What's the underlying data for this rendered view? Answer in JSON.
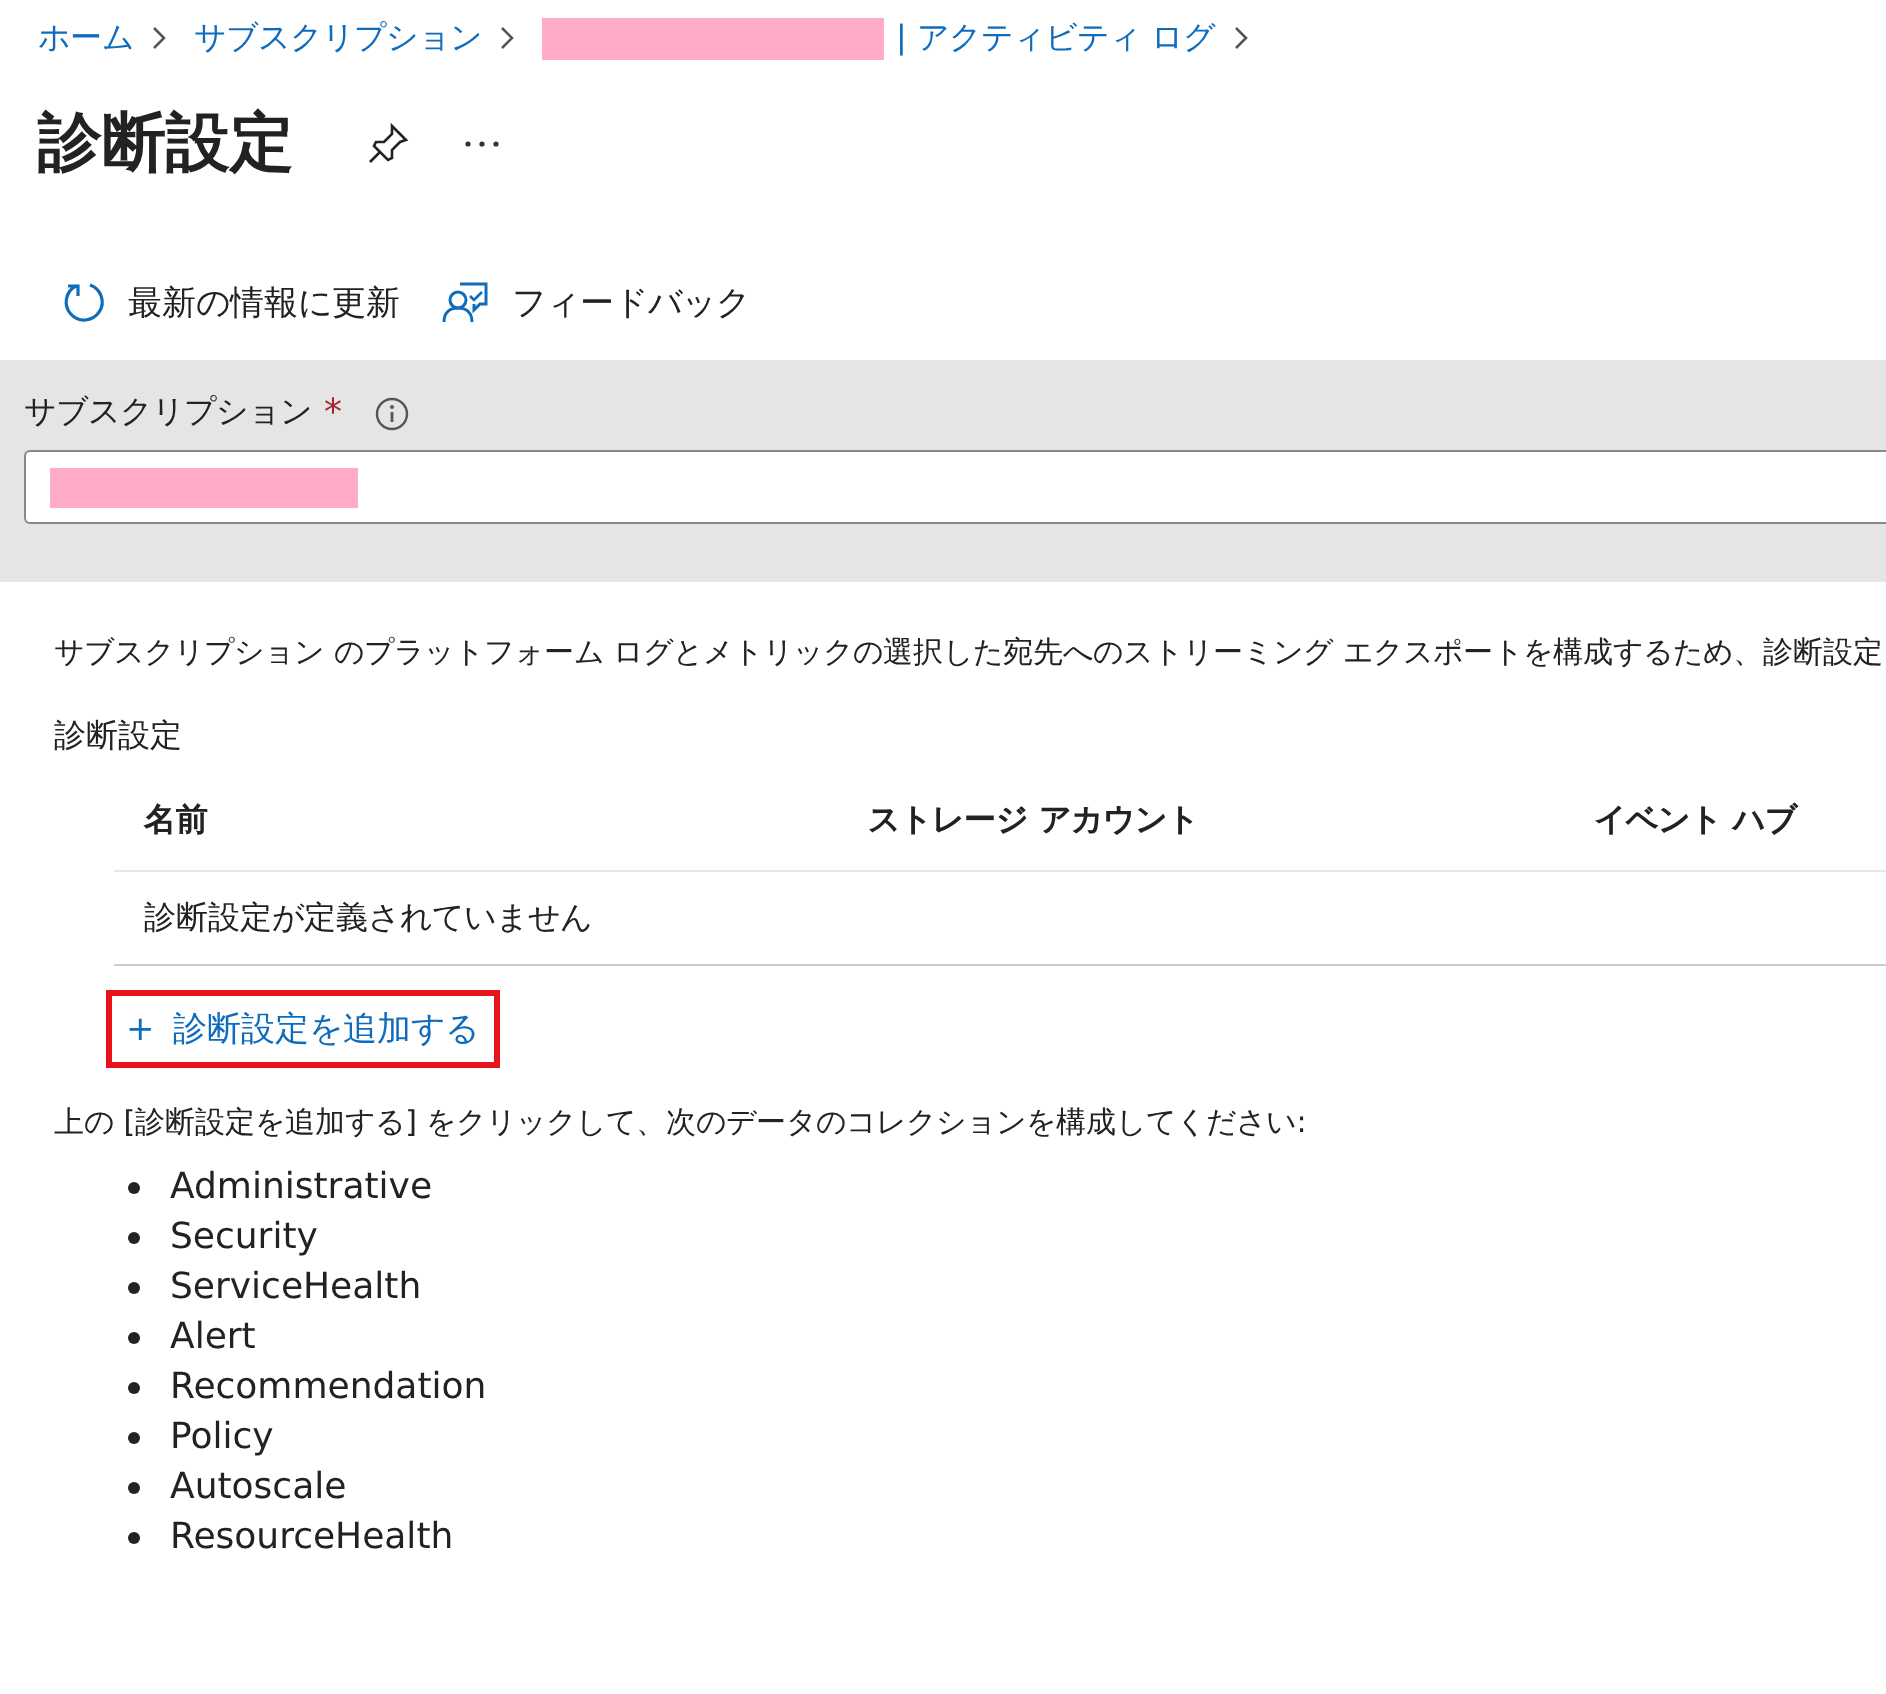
{
  "breadcrumbs": [
    {
      "label": "ホーム"
    },
    {
      "label": "サブスクリプション"
    },
    {
      "label": "| アクティビティ ログ"
    }
  ],
  "title": "診断設定",
  "toolbar": [
    {
      "label": "最新の情報に更新",
      "kind": "refresh"
    },
    {
      "label": "フィードバック",
      "kind": "feedback"
    }
  ],
  "subscription_field": {
    "label": "サブスクリプション",
    "required_mark": "*"
  },
  "description": "サブスクリプション のプラットフォーム ログとメトリックの選択した宛先へのストリーミング エクスポートを構成するため、診断設定",
  "section_title": "診断設定",
  "table": {
    "columns": [
      "名前",
      "ストレージ アカウント",
      "イベント ハブ"
    ],
    "empty_message": "診断設定が定義されていません"
  },
  "add_link": {
    "icon": "+",
    "label": "診断設定を追加する",
    "highlighted": true
  },
  "instruction": "上の [診断設定を追加する] をクリックして、次のデータのコレクションを構成してください:",
  "categories": [
    "Administrative",
    "Security",
    "ServiceHealth",
    "Alert",
    "Recommendation",
    "Policy",
    "Autoscale",
    "ResourceHealth"
  ]
}
